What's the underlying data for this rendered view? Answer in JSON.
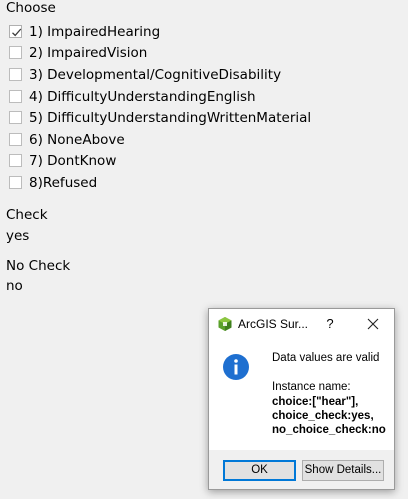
{
  "question": {
    "title": "Choose",
    "options": [
      {
        "label": "1) ImpairedHearing",
        "checked": true
      },
      {
        "label": "2) ImpairedVision",
        "checked": false
      },
      {
        "label": "3) Developmental/CognitiveDisability",
        "checked": false
      },
      {
        "label": "4) DifficultyUnderstandingEnglish",
        "checked": false
      },
      {
        "label": "5) DifficultyUnderstandingWrittenMaterial",
        "checked": false
      },
      {
        "label": "6) NoneAbove",
        "checked": false
      },
      {
        "label": "7) DontKnow",
        "checked": false
      },
      {
        "label": "8)Refused",
        "checked": false
      }
    ]
  },
  "check": {
    "title": "Check",
    "value": "yes"
  },
  "no_check": {
    "title": "No Check",
    "value": "no"
  },
  "dialog": {
    "title": "ArcGIS Sur...",
    "help_glyph": "?",
    "message": "Data values are valid",
    "detail_label": "Instance name:",
    "detail": "choice:[\"hear\"], choice_check:yes, no_choice_check:no",
    "ok_label": "OK",
    "details_label": "Show Details...",
    "icons": {
      "app": "arcgis-survey123-icon",
      "info": "info-icon",
      "close": "close-icon"
    },
    "colors": {
      "info": "#1e6fd0",
      "ok_border": "#0078d7"
    }
  }
}
